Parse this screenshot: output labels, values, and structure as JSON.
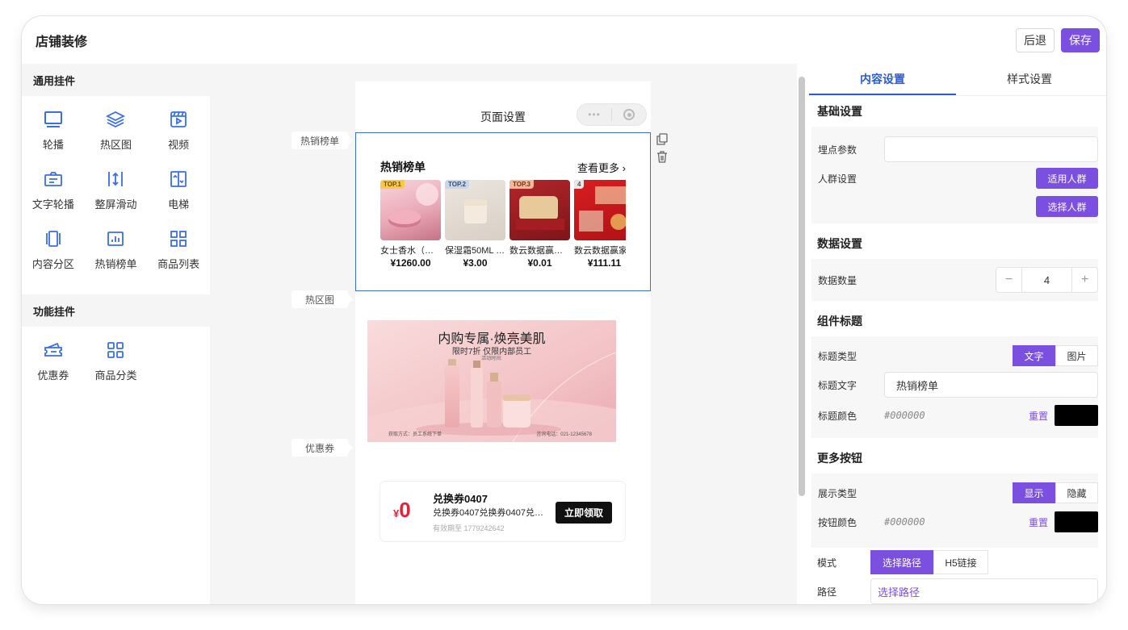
{
  "header": {
    "title": "店铺装修",
    "back_label": "后退",
    "save_label": "保存"
  },
  "left": {
    "general_title": "通用挂件",
    "general_items": [
      {
        "label": "轮播",
        "icon": "carousel-icon"
      },
      {
        "label": "热区图",
        "icon": "layers-icon"
      },
      {
        "label": "视频",
        "icon": "video-icon"
      },
      {
        "label": "文字轮播",
        "icon": "text-carousel-icon"
      },
      {
        "label": "整屏滑动",
        "icon": "fullscreen-swipe-icon"
      },
      {
        "label": "电梯",
        "icon": "elevator-icon"
      },
      {
        "label": "内容分区",
        "icon": "content-section-icon"
      },
      {
        "label": "热销榜单",
        "icon": "bestseller-chart-icon"
      },
      {
        "label": "商品列表",
        "icon": "grid-icon"
      }
    ],
    "function_title": "功能挂件",
    "function_items": [
      {
        "label": "优惠券",
        "icon": "coupon-icon"
      },
      {
        "label": "商品分类",
        "icon": "category-grid-icon"
      }
    ]
  },
  "canvas": {
    "tags": [
      "热销榜单",
      "热区图",
      "优惠券"
    ],
    "page_title": "页面设置",
    "capsule_dots": "•••",
    "hot": {
      "title": "热销榜单",
      "more": "查看更多",
      "products": [
        {
          "rank": "TOP.1",
          "name": "女士香水（茉…",
          "price": "¥1260.00",
          "rank_bg": "#f7c948",
          "rank_color": "#7a4a00"
        },
        {
          "rank": "TOP.2",
          "name": "保湿霜50ML …",
          "price": "¥3.00",
          "rank_bg": "#c9d6ea",
          "rank_color": "#3a4e74"
        },
        {
          "rank": "TOP.3",
          "name": "数云数据赢家…",
          "price": "¥0.01",
          "rank_bg": "#f3b79a",
          "rank_color": "#7a3312"
        },
        {
          "rank": "4",
          "name": "数云数据赢家",
          "price": "¥111.11",
          "rank_bg": "#e8e8e8",
          "rank_color": "#555"
        }
      ]
    },
    "banner": {
      "headline": "内购专属·焕亮美肌",
      "sub": "限时7折 仅限内部员工",
      "time": "活动时间:",
      "left_note": "获取方式：员工系统下单",
      "right_note": "咨询电话：021-12345678"
    },
    "coupon": {
      "currency": "¥",
      "amount": "0",
      "name": "兑换券0407",
      "desc": "兑换券0407兑换券0407兑换券0407",
      "expiry": "有效期至 1779242642",
      "button": "立即领取"
    }
  },
  "right": {
    "tabs": [
      "内容设置",
      "样式设置"
    ],
    "basic": {
      "title": "基础设置",
      "tracking_label": "埋点参数",
      "tracking_value": "",
      "crowd_label": "人群设置",
      "apply_crowd": "适用人群",
      "select_crowd": "选择人群"
    },
    "data": {
      "title": "数据设置",
      "count_label": "数据数量",
      "count": "4",
      "minus": "−",
      "plus": "+"
    },
    "comp_title": {
      "title": "组件标题",
      "type_label": "标题类型",
      "type_options": [
        "文字",
        "图片"
      ],
      "text_label": "标题文字",
      "text_value": "热销榜单",
      "color_label": "标题颜色",
      "color_value": "#000000",
      "reset": "重置"
    },
    "more_btn": {
      "title": "更多按钮",
      "display_label": "展示类型",
      "display_options": [
        "显示",
        "隐藏"
      ],
      "color_label": "按钮颜色",
      "color_value": "#000000",
      "reset": "重置",
      "mode_label": "模式",
      "mode_options": [
        "选择路径",
        "H5链接"
      ],
      "path_label": "路径",
      "path_value": "选择路径"
    }
  },
  "colors": {
    "accent": "#7b4fe0",
    "link_blue": "#2d5cce",
    "coupon_red": "#e0243e"
  }
}
